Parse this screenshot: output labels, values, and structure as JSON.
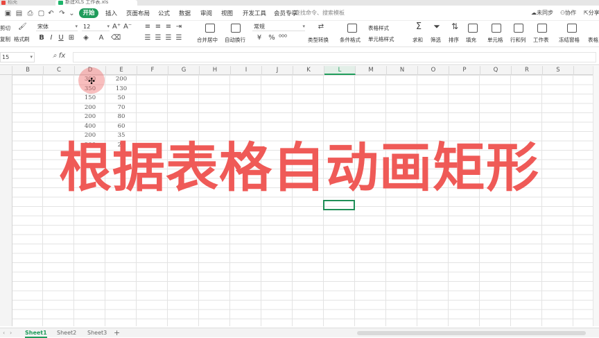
{
  "titlebar": {
    "tab_prev": "稻壳",
    "tab_active": "新建XLS 工作表.xls"
  },
  "menu": {
    "items": [
      "开始",
      "插入",
      "页面布局",
      "公式",
      "数据",
      "审阅",
      "视图",
      "开发工具",
      "会员专享"
    ],
    "search_placeholder": "查找命令、搜索模板",
    "right": {
      "sync": "未同步",
      "collab": "协作",
      "share": "分享"
    }
  },
  "ribbon": {
    "cut": "剪切",
    "copy": "复制",
    "format_painter": "格式刷",
    "font_name": "宋体",
    "font_size": "12",
    "merge_center": "合并居中",
    "wrap_text": "自动换行",
    "number_format": "常规",
    "type_convert": "类型转换",
    "table_style": "表格样式",
    "conditional_format": "条件格式",
    "cell_style": "单元格样式",
    "sum": "求和",
    "filter": "筛选",
    "sort": "排序",
    "fill": "填充",
    "cell": "单元格",
    "row_col": "行和列",
    "worksheet": "工作表",
    "freeze": "冻结窗格",
    "table_tools": "表格工具"
  },
  "formula_bar": {
    "name_box": "15",
    "fx": "fx"
  },
  "columns": [
    "B",
    "C",
    "D",
    "E",
    "F",
    "G",
    "H",
    "I",
    "J",
    "K",
    "L",
    "M",
    "N",
    "O",
    "P",
    "Q",
    "R",
    "S"
  ],
  "selected_column": "L",
  "data": {
    "col_d": [
      "300",
      "350",
      "150",
      "200",
      "200",
      "400",
      "200",
      "200"
    ],
    "col_e": [
      "200",
      "130",
      "50",
      "70",
      "80",
      "60",
      "35",
      "20"
    ]
  },
  "overlay_title": "根据表格自动画矩形",
  "sheets": [
    "Sheet1",
    "Sheet2",
    "Sheet3"
  ],
  "colors": {
    "accent": "#1f9c5b",
    "overlay": "#ef5a57"
  }
}
